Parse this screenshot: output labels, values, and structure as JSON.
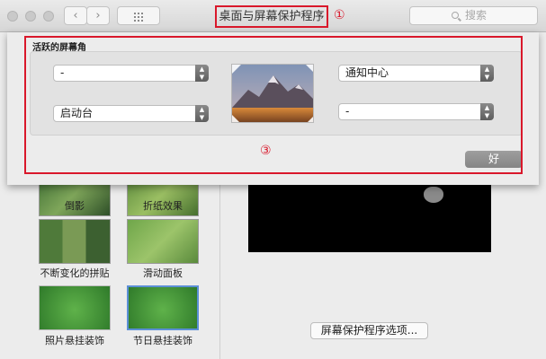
{
  "window": {
    "title": "桌面与屏幕保护程序",
    "search_placeholder": "搜索"
  },
  "annotations": {
    "one": "①",
    "three": "③"
  },
  "hot_corners": {
    "label": "活跃的屏幕角",
    "top_left": "-",
    "bottom_left": "启动台",
    "top_right": "通知中心",
    "bottom_right": "-",
    "ok_label": "好"
  },
  "screensavers": [
    {
      "label": "倒影"
    },
    {
      "label": "折纸效果"
    },
    {
      "label": "不断变化的拼贴"
    },
    {
      "label": "滑动面板"
    },
    {
      "label": "照片悬挂装饰"
    },
    {
      "label": "节日悬挂装饰"
    }
  ],
  "preview": {
    "options_label": "屏幕保护程序选项..."
  },
  "icons": [
    "nav-back-icon",
    "nav-forward-icon",
    "show-all-grid-icon",
    "search-icon",
    "apple-logo-icon",
    "select-arrow-icon"
  ],
  "colors": {
    "annotation": "#d9182b",
    "ok_button": "#8f8f8f"
  }
}
